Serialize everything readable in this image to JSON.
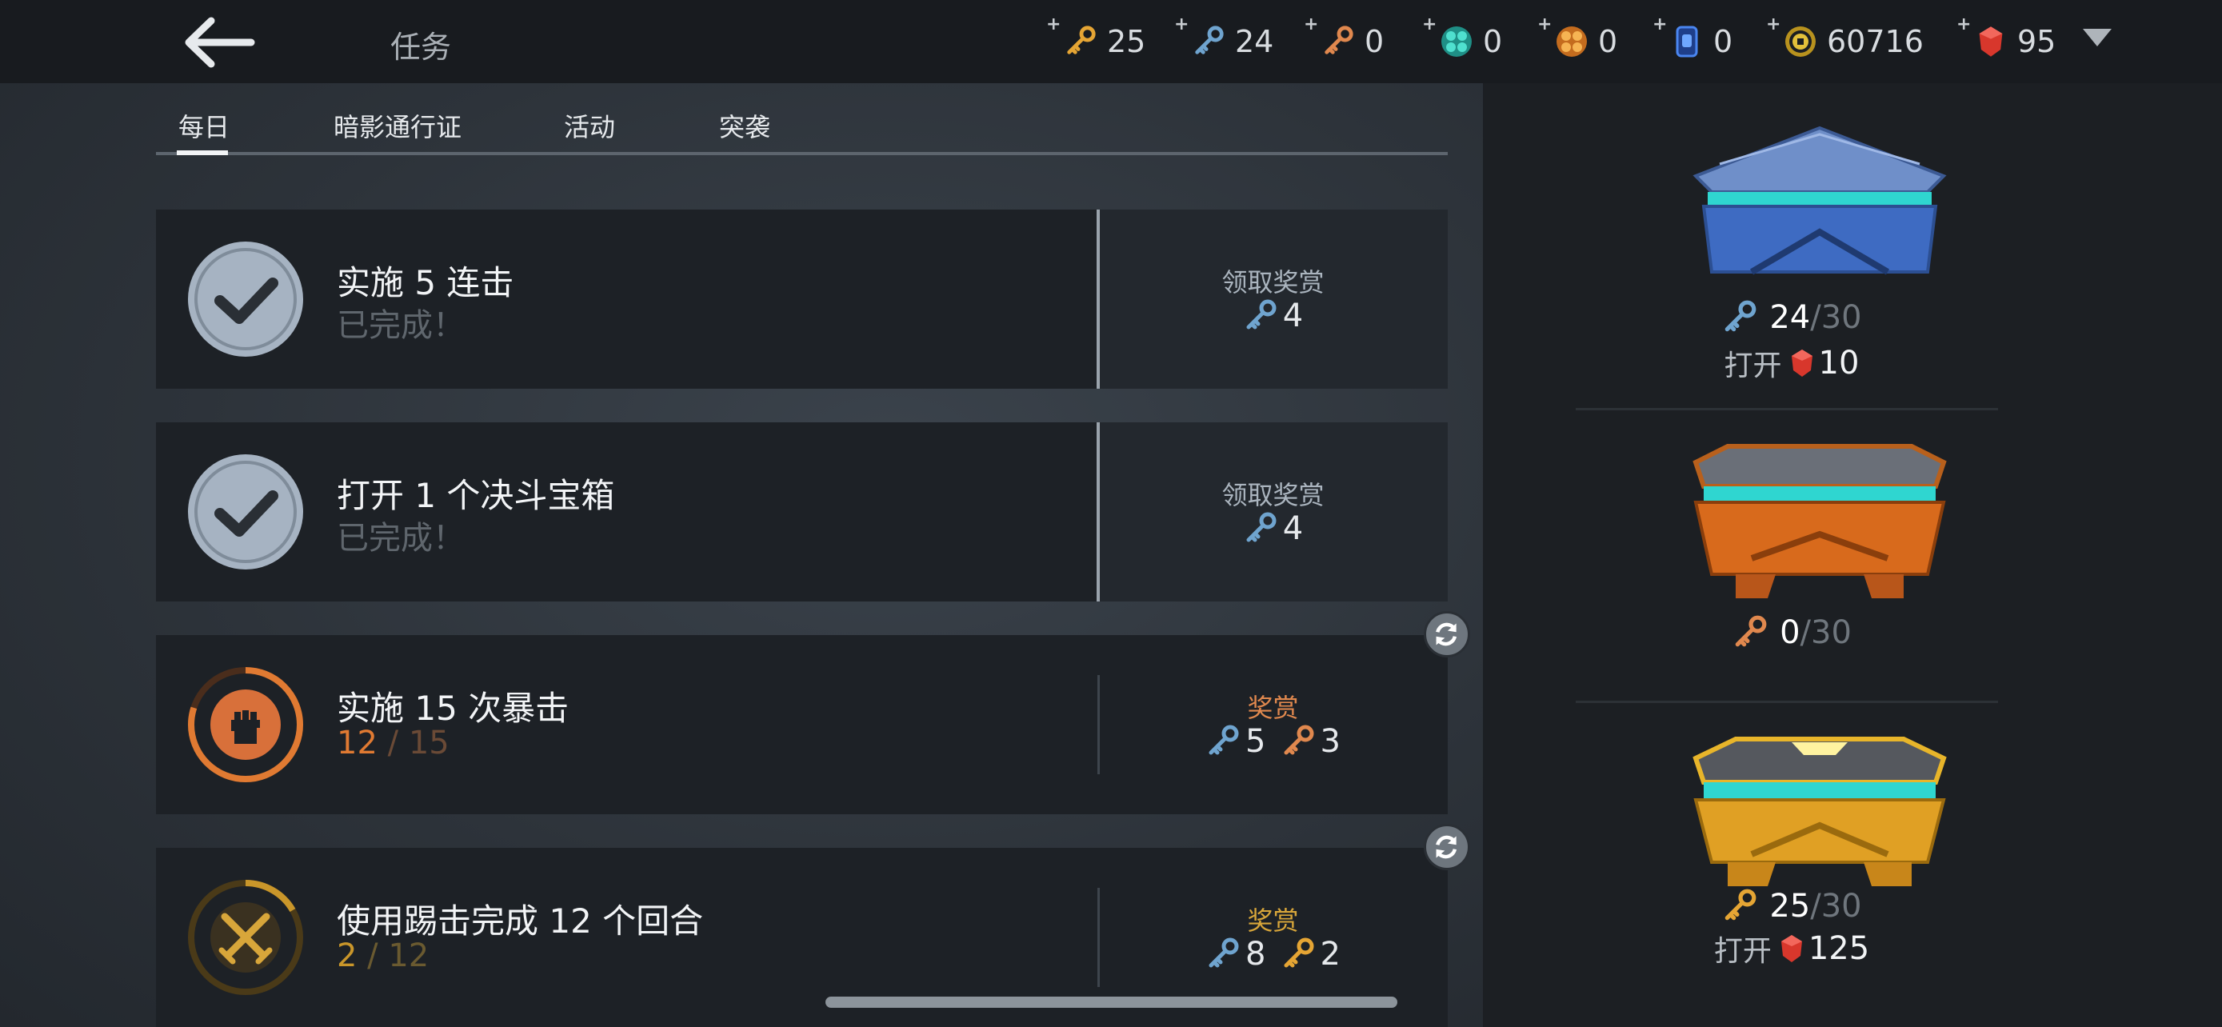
{
  "header": {
    "title": "任务",
    "currencies": [
      {
        "icon": "gold-key-icon",
        "value": "25",
        "color": "#e5a534"
      },
      {
        "icon": "silver-key-icon",
        "value": "24",
        "color": "#6fa4cf"
      },
      {
        "icon": "bronze-key-icon",
        "value": "0",
        "color": "#e0884e"
      },
      {
        "icon": "teal-orb-icon",
        "value": "0",
        "color": "#2fb7a6"
      },
      {
        "icon": "orange-orb-icon",
        "value": "0",
        "color": "#e08a2c"
      },
      {
        "icon": "blue-card-icon",
        "value": "0",
        "color": "#3b72d6"
      },
      {
        "icon": "coin-icon",
        "value": "60716",
        "color": "#d8b22a"
      },
      {
        "icon": "ruby-icon",
        "value": "95",
        "color": "#d43a2f"
      }
    ]
  },
  "tabs": [
    "每日",
    "暗影通行证",
    "活动",
    "突袭"
  ],
  "quests": [
    {
      "name": "实施 5 连击",
      "status": "已完成！",
      "reward_label": "领取奖赏",
      "rewards": [
        {
          "icon": "silver-key-icon",
          "value": "4"
        }
      ]
    },
    {
      "name": "打开 1 个决斗宝箱",
      "status": "已完成！",
      "reward_label": "领取奖赏",
      "rewards": [
        {
          "icon": "silver-key-icon",
          "value": "4"
        }
      ]
    },
    {
      "name": "实施 15 次暴击",
      "progress": {
        "current": "12",
        "sep": " / ",
        "total": "15"
      },
      "progress_fraction": 0.8,
      "reward_label": "奖赏",
      "rewards": [
        {
          "icon": "silver-key-icon",
          "value": "5"
        },
        {
          "icon": "bronze-key-icon",
          "value": "3"
        }
      ]
    },
    {
      "name": "使用踢击完成 12 个回合",
      "progress": {
        "current": "2",
        "sep": " / ",
        "total": "12"
      },
      "progress_fraction": 0.1667,
      "reward_label": "奖赏",
      "rewards": [
        {
          "icon": "silver-key-icon",
          "value": "8"
        },
        {
          "icon": "gold-key-icon",
          "value": "2"
        }
      ]
    }
  ],
  "chests": [
    {
      "type": "silver-chest",
      "count": "24",
      "sep": " / ",
      "max": "30",
      "open_label": "打开",
      "open_cost": "10"
    },
    {
      "type": "bronze-chest",
      "count": "0",
      "sep": " / ",
      "max": "30"
    },
    {
      "type": "gold-chest",
      "count": "25",
      "sep": " / ",
      "max": "30",
      "open_label": "打开",
      "open_cost": "125"
    }
  ],
  "colors": {
    "orange_accent": "#e07a32",
    "gold_accent": "#c9962a",
    "completed": "#a6b3c2"
  }
}
